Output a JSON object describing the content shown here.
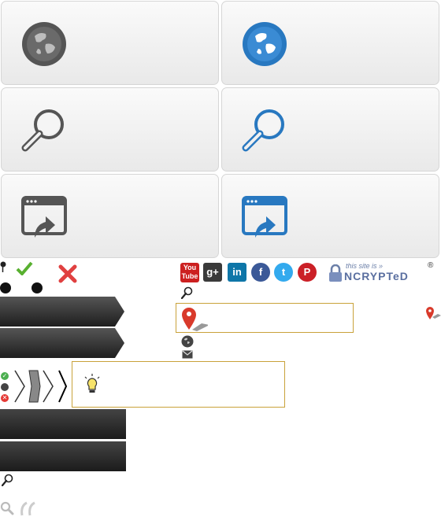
{
  "tiles": [
    {
      "icon": "globe-icon",
      "color": "#555555"
    },
    {
      "icon": "globe-icon",
      "color": "#2878c0"
    },
    {
      "icon": "search-icon",
      "color": "#555555"
    },
    {
      "icon": "search-icon",
      "color": "#2878c0"
    },
    {
      "icon": "window-export-icon",
      "color": "#555555"
    },
    {
      "icon": "window-export-icon",
      "color": "#2878c0"
    }
  ],
  "social": [
    {
      "name": "youtube",
      "label": "You Tube",
      "color": "#cc2020"
    },
    {
      "name": "google-plus",
      "label": "g+",
      "color": "#3a3a3a"
    },
    {
      "name": "linkedin",
      "label": "in",
      "color": "#0e76a8"
    },
    {
      "name": "facebook",
      "label": "f",
      "color": "#3b5998"
    },
    {
      "name": "twitter",
      "label": "t",
      "color": "#33aaee"
    },
    {
      "name": "pinterest",
      "label": "P",
      "color": "#cb2027"
    }
  ],
  "badge": {
    "top_text": "this site is »",
    "main_text": "NCRYPTeD",
    "registered": "®"
  },
  "colors": {
    "accent": "#2878c0",
    "gold": "#c9a23a",
    "success": "#4caf50",
    "error": "#e53935"
  }
}
